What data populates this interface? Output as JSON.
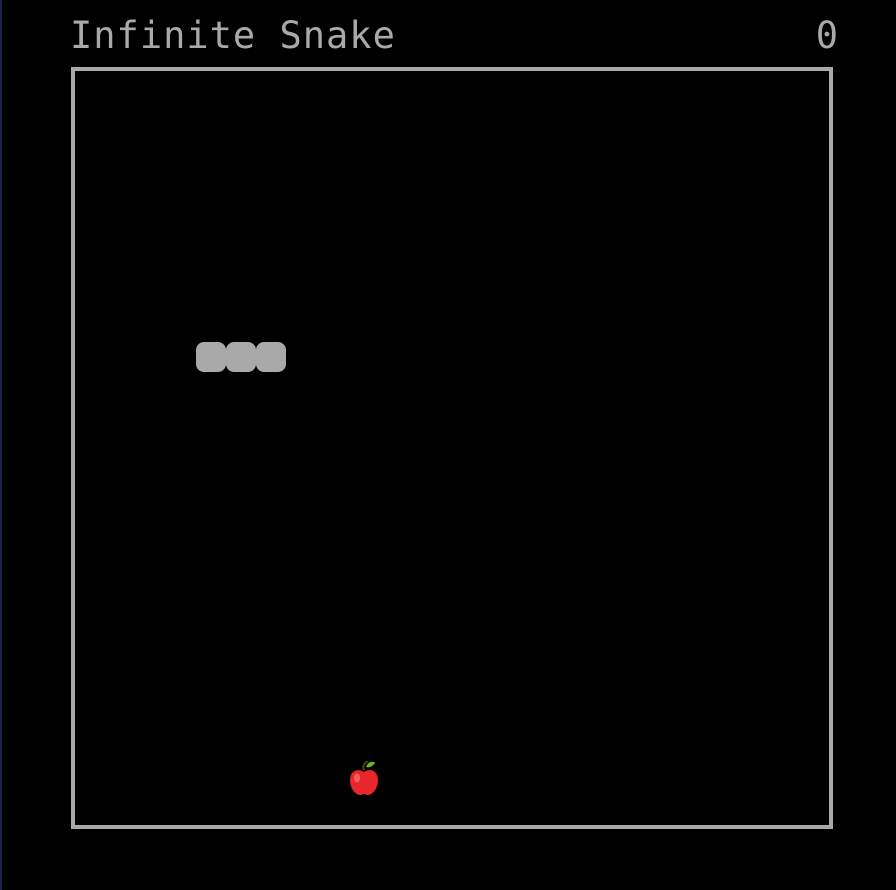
{
  "game": {
    "title": "Infinite Snake",
    "score": "0"
  },
  "snake": {
    "length": 3,
    "color": "#a9a9a9",
    "icon": "snake-segment"
  },
  "food": {
    "icon": "apple-icon",
    "color": "#e8262b"
  },
  "board": {
    "border_color": "#a9a9a9",
    "background": "#000000"
  }
}
